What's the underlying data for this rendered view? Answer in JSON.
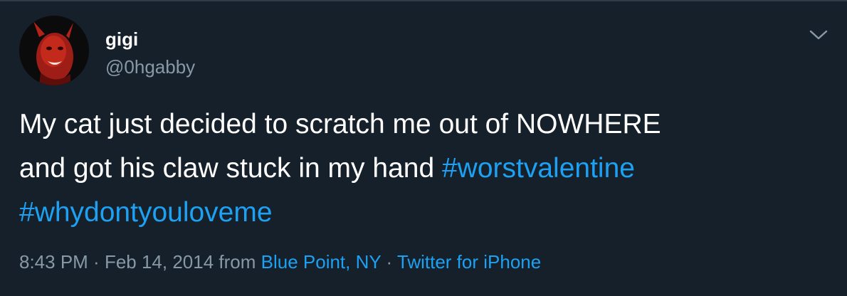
{
  "colors": {
    "background": "#15202b",
    "text": "#ffffff",
    "secondary": "#8899a6",
    "accent": "#1da1f2"
  },
  "tweet": {
    "author": {
      "name": "gigi",
      "handle": "@0hgabby",
      "avatar_icon": "avatar-image"
    },
    "menu_icon": "chevron-down-icon",
    "text": {
      "line1": "My cat just decided to scratch me out of NOWHERE",
      "line2_plain": "and got his claw stuck in my hand ",
      "hashtag1": "#worstvalentine",
      "hashtag2": "#whydontyouloveme"
    },
    "meta": {
      "time": "8:43 PM",
      "separator": " · ",
      "date": "Feb 14, 2014",
      "from": " from ",
      "location": "Blue Point, NY",
      "separator2": " · ",
      "source": "Twitter for iPhone"
    }
  }
}
